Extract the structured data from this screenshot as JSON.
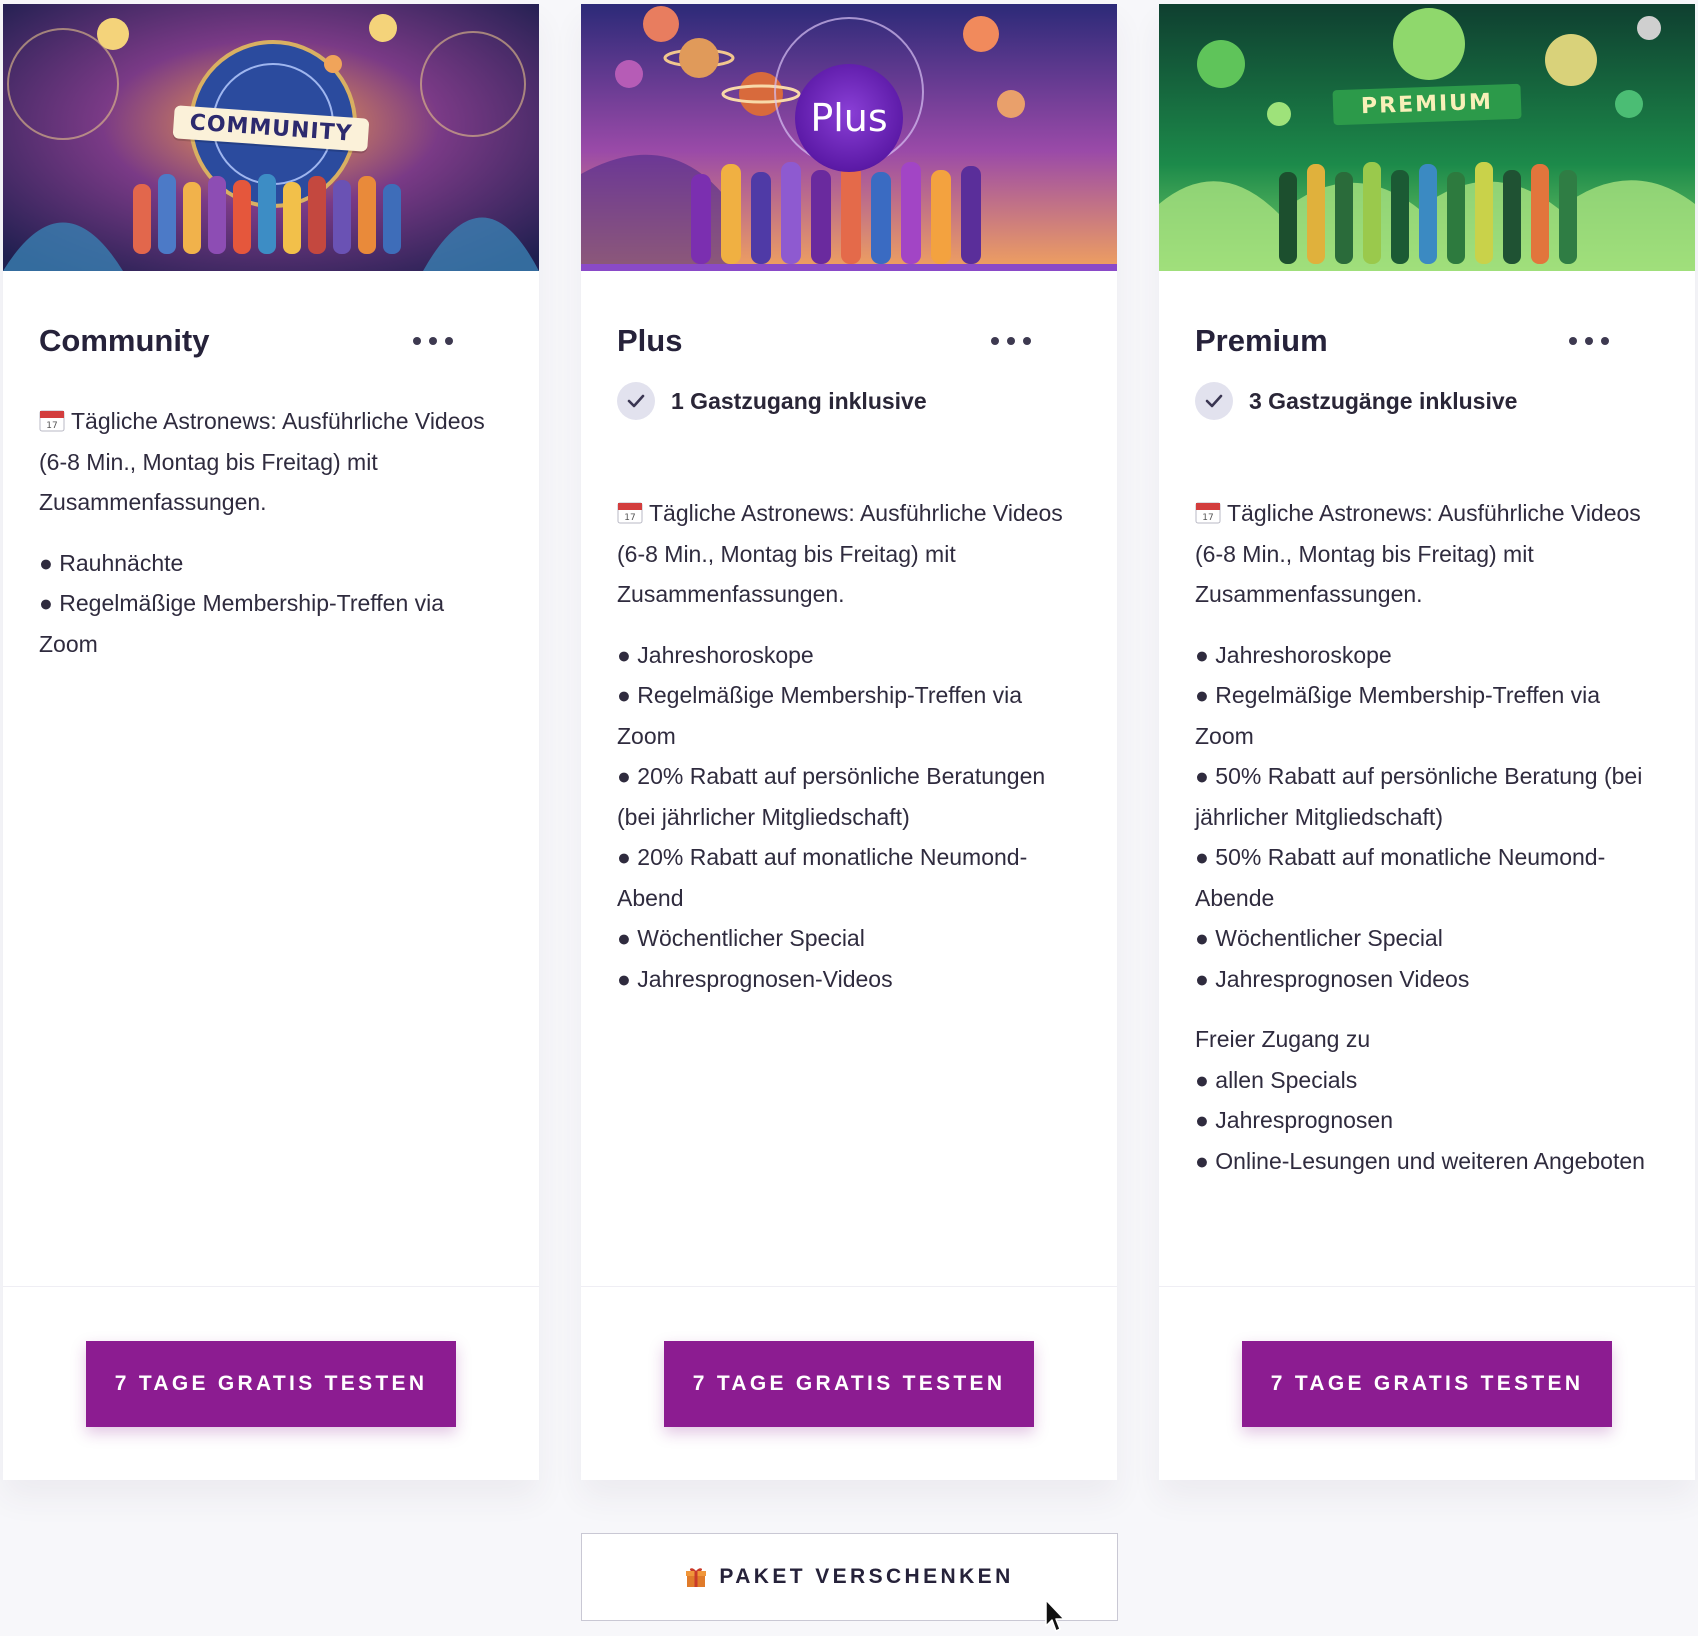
{
  "cards": [
    {
      "title": "Community",
      "banner_label": "COMMUNITY",
      "guest": null,
      "intro": "Tägliche Astronews: Ausführliche Videos (6-8 Min., Montag bis Freitag) mit Zusammenfassungen.",
      "features": [
        "● Rauhnächte",
        "● Regelmäßige Membership-Treffen via Zoom"
      ],
      "extra": null,
      "cta": "7 TAGE GRATIS TESTEN"
    },
    {
      "title": "Plus",
      "banner_label": "Plus",
      "guest": "1 Gastzugang inklusive",
      "intro": "Tägliche Astronews: Ausführliche Videos (6-8 Min., Montag bis Freitag) mit Zusammenfassungen.",
      "features": [
        "● Jahreshoroskope",
        "● Regelmäßige Membership-Treffen via Zoom",
        "● 20% Rabatt auf persönliche Beratungen (bei jährlicher Mitgliedschaft)",
        "● 20% Rabatt auf monatliche Neumond-Abend",
        "● Wöchentlicher Special",
        "● Jahresprognosen-Videos"
      ],
      "extra": null,
      "cta": "7 TAGE GRATIS TESTEN"
    },
    {
      "title": "Premium",
      "banner_label": "PREMIUM",
      "guest": "3 Gastzugänge inklusive",
      "intro": "Tägliche Astronews: Ausführliche Videos (6-8 Min., Montag bis Freitag) mit Zusammenfassungen.",
      "features": [
        "● Jahreshoroskope",
        "● Regelmäßige Membership-Treffen via Zoom",
        "● 50% Rabatt auf persönliche Beratung (bei jährlicher Mitgliedschaft)",
        "● 50% Rabatt auf monatliche Neumond-Abende",
        "● Wöchentlicher Special",
        "● Jahresprognosen Videos"
      ],
      "extra": [
        "Freier Zugang zu",
        "● allen Specials",
        "● Jahresprognosen",
        "● Online-Lesungen und weiteren Angeboten"
      ],
      "cta": "7 TAGE GRATIS TESTEN"
    }
  ],
  "gift_button": {
    "label": "PAKET VERSCHENKEN",
    "icon": "gift-icon"
  },
  "colors": {
    "accent": "#8c1c91",
    "text": "#2a2637",
    "check_bg": "#e2e2ee"
  }
}
